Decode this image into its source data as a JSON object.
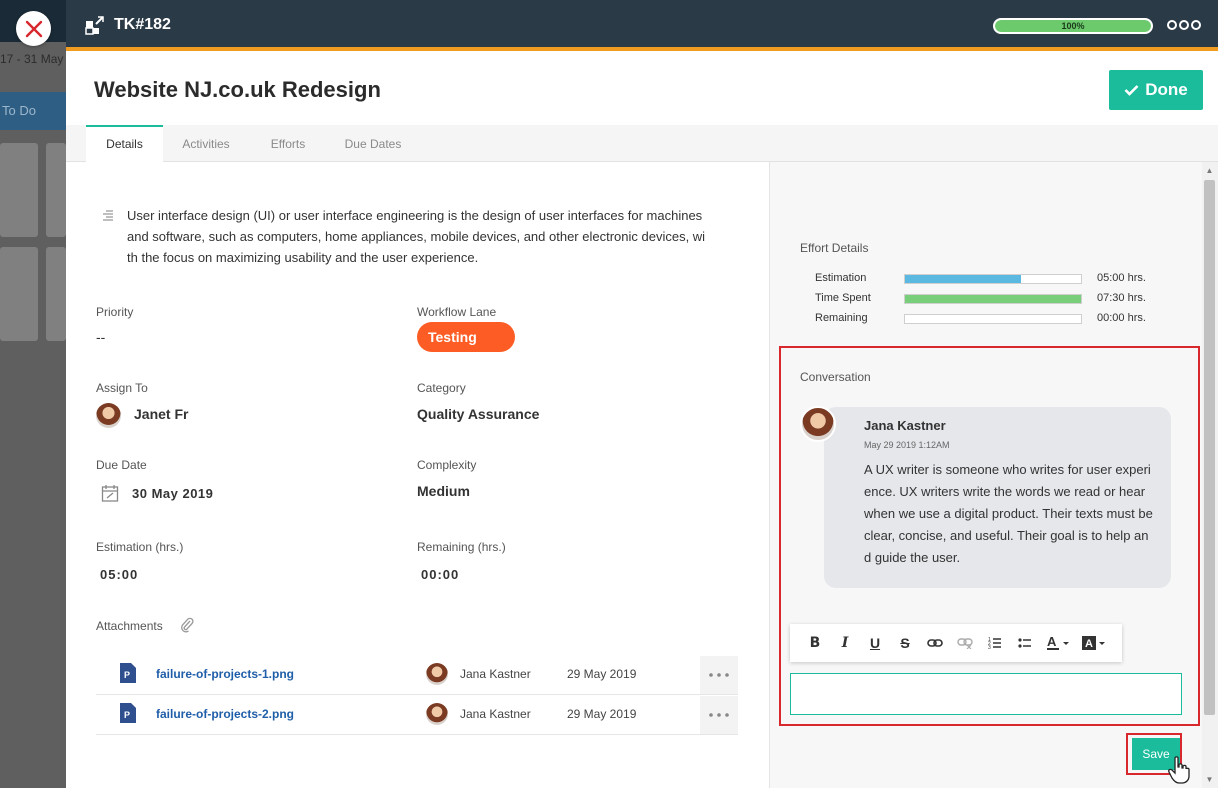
{
  "background": {
    "date_range": "17 - 31 May",
    "column_label": "To Do"
  },
  "header": {
    "ticket_id": "TK#182",
    "progress_label": "100%",
    "progress_value": 1.0
  },
  "task": {
    "title": "Website NJ.co.uk Redesign",
    "done_label": "Done"
  },
  "tabs": [
    {
      "label": "Details"
    },
    {
      "label": "Activities"
    },
    {
      "label": "Efforts"
    },
    {
      "label": "Due Dates"
    }
  ],
  "details": {
    "description": "User interface design (UI) or user interface engineering is the design of user interfaces for machines and software, such as computers, home appliances, mobile devices, and other electronic devices, with the focus on maximizing usability and the user experience.",
    "priority_label": "Priority",
    "priority_value": "--",
    "workflow_label": "Workflow Lane",
    "workflow_value": "Testing",
    "assign_label": "Assign To",
    "assign_value": "Janet Fr",
    "category_label": "Category",
    "category_value": "Quality Assurance",
    "due_label": "Due Date",
    "due_value": "30 May 2019",
    "complexity_label": "Complexity",
    "complexity_value": "Medium",
    "estimation_label": "Estimation (hrs.)",
    "estimation_value": "05:00",
    "remaining_label": "Remaining (hrs.)",
    "remaining_value": "00:00",
    "attachments_label": "Attachments"
  },
  "attachments": [
    {
      "name": "failure-of-projects-1.png",
      "user": "Jana Kastner",
      "date": "29 May 2019"
    },
    {
      "name": "failure-of-projects-2.png",
      "user": "Jana Kastner",
      "date": "29 May 2019"
    }
  ],
  "effort": {
    "title": "Effort Details",
    "rows": [
      {
        "label": "Estimation",
        "value": "05:00 hrs.",
        "fill": 0.66,
        "color": "#5bb8e0"
      },
      {
        "label": "Time Spent",
        "value": "07:30 hrs.",
        "fill": 1.0,
        "color": "#79cf79"
      },
      {
        "label": "Remaining",
        "value": "00:00 hrs.",
        "fill": 0.0,
        "color": "#cccccc"
      }
    ]
  },
  "conversation": {
    "title": "Conversation",
    "message": {
      "author": "Jana Kastner",
      "time": "May 29 2019 1:12AM",
      "text": "A UX writer is someone who writes for user experience. UX writers write the words we read or hear when we use a digital product. Their texts must be clear, concise, and useful. Their goal is to help and guide the user."
    },
    "input_value": "",
    "save_label": "Save"
  },
  "colors": {
    "accent": "#1abc9c",
    "header_bg": "#2b3a47",
    "header_border": "#f29c1f",
    "lane_badge": "#fd5d25",
    "highlight": "#d9272e"
  }
}
